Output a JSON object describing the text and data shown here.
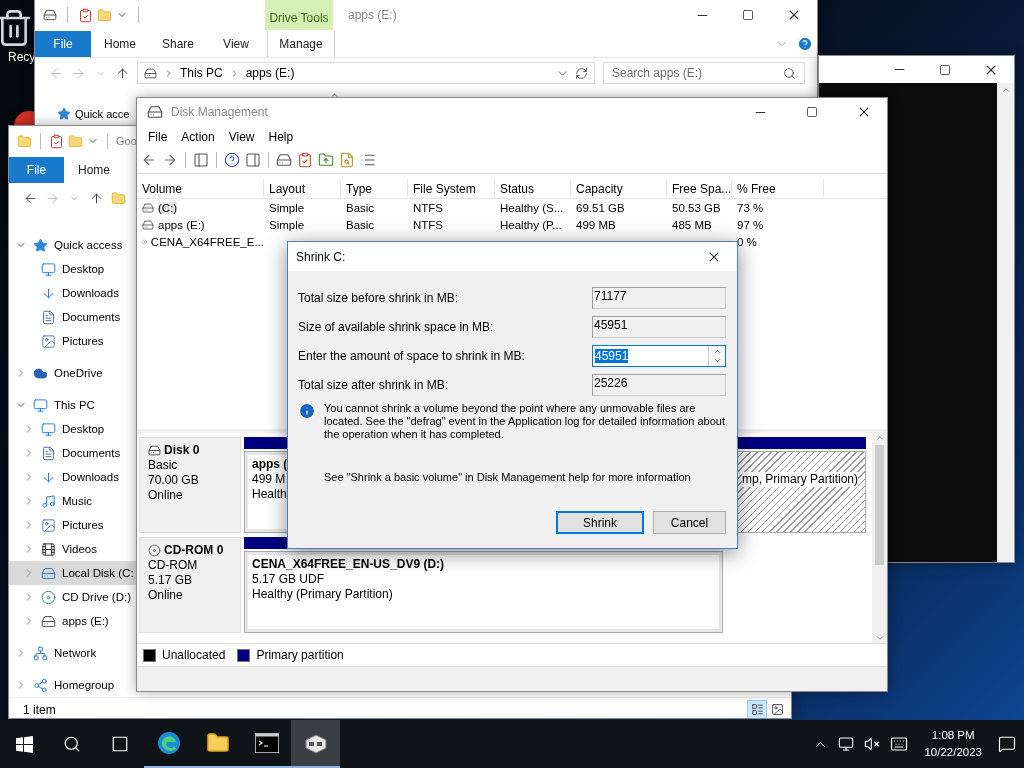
{
  "desktop": {
    "icons": [
      {
        "label": "Recy"
      }
    ]
  },
  "back_explorer": {
    "title": "apps (E:)",
    "context_tab": "Drive Tools",
    "ribbon_tabs": [
      {
        "label": "File",
        "kind": "file"
      },
      {
        "label": "Home",
        "kind": "tab"
      },
      {
        "label": "Share",
        "kind": "tab"
      },
      {
        "label": "View",
        "kind": "tab"
      },
      {
        "label": "Manage",
        "kind": "context"
      }
    ],
    "breadcrumb": [
      "This PC",
      "apps (E:)"
    ],
    "search": {
      "placeholder": "Search apps (E:)"
    },
    "nav_peek": "Quick acce"
  },
  "front_explorer": {
    "title_peek": "Goo",
    "ribbon_tabs": [
      {
        "label": "File",
        "kind": "file"
      },
      {
        "label": "Home",
        "kind": "tab"
      }
    ],
    "nav_tree": [
      {
        "label": "Quick access",
        "kind": "star",
        "expanded": true,
        "selected": false,
        "children": [
          {
            "label": "Desktop",
            "kind": "desktop",
            "selected": false
          },
          {
            "label": "Downloads",
            "kind": "downloads",
            "selected": false
          },
          {
            "label": "Documents",
            "kind": "documents",
            "selected": false
          },
          {
            "label": "Pictures",
            "kind": "pictures",
            "selected": false
          }
        ]
      },
      {
        "label": "OneDrive",
        "kind": "cloud",
        "expanded": false,
        "selected": false
      },
      {
        "label": "This PC",
        "kind": "pc",
        "expanded": true,
        "selected": false,
        "children": [
          {
            "label": "Desktop",
            "kind": "desktop",
            "expanded": false,
            "selected": false
          },
          {
            "label": "Documents",
            "kind": "documents",
            "expanded": false,
            "selected": false
          },
          {
            "label": "Downloads",
            "kind": "downloads",
            "expanded": false,
            "selected": false
          },
          {
            "label": "Music",
            "kind": "music",
            "expanded": false,
            "selected": false
          },
          {
            "label": "Pictures",
            "kind": "pictures",
            "expanded": false,
            "selected": false
          },
          {
            "label": "Videos",
            "kind": "videos",
            "expanded": false,
            "selected": false
          },
          {
            "label": "Local Disk (C:",
            "kind": "localdisk",
            "expanded": false,
            "selected": true
          },
          {
            "label": "CD Drive (D:)",
            "kind": "cd",
            "expanded": false,
            "selected": false
          },
          {
            "label": "apps (E:)",
            "kind": "drive",
            "expanded": false,
            "selected": false
          }
        ]
      },
      {
        "label": "Network",
        "kind": "network",
        "expanded": false,
        "selected": false
      },
      {
        "label": "Homegroup",
        "kind": "homegroup",
        "expanded": false,
        "selected": false
      }
    ],
    "status": "1 item"
  },
  "disk_management": {
    "title": "Disk Management",
    "menu": [
      "File",
      "Action",
      "View",
      "Help"
    ],
    "columns": [
      "Volume",
      "Layout",
      "Type",
      "File System",
      "Status",
      "Capacity",
      "Free Spa...",
      "% Free"
    ],
    "rows": [
      {
        "kind": "disk",
        "cells": [
          "(C:)",
          "Simple",
          "Basic",
          "NTFS",
          "Healthy (S...",
          "69.51 GB",
          "50.53 GB",
          "73 %"
        ],
        "selected": true
      },
      {
        "kind": "disk",
        "cells": [
          "apps (E:)",
          "Simple",
          "Basic",
          "NTFS",
          "Healthy (P...",
          "499 MB",
          "485 MB",
          "97 %"
        ],
        "selected": false
      },
      {
        "kind": "cd",
        "cells": [
          "CENA_X64FREE_E...",
          "",
          "",
          "",
          "",
          "",
          "",
          "0 %"
        ],
        "selected": false
      }
    ],
    "disks": [
      {
        "name": "Disk 0",
        "kind": "disk",
        "lines": [
          "Basic",
          "70.00 GB",
          "Online"
        ],
        "partitions": [
          {
            "title": "apps (",
            "lines": [
              "499 M",
              "Health"
            ],
            "selected": false
          },
          {
            "lines": [
              "mp, Primary Partition)"
            ],
            "selected": true
          }
        ]
      },
      {
        "name": "CD-ROM 0",
        "kind": "cd",
        "lines": [
          "CD-ROM",
          "5.17 GB",
          "Online"
        ],
        "partitions": [
          {
            "title": "CENA_X64FREE_EN-US_DV9  (D:)",
            "lines": [
              "5.17 GB UDF",
              "Healthy (Primary Partition)"
            ],
            "selected": false
          }
        ]
      }
    ],
    "legend": [
      {
        "label": "Unallocated",
        "color": "#000000"
      },
      {
        "label": "Primary partition",
        "color": "#000080"
      }
    ]
  },
  "dialog": {
    "title": "Shrink C:",
    "fields": [
      {
        "label": "Total size before shrink in MB:",
        "value": "71177",
        "kind": "readonly"
      },
      {
        "label": "Size of available shrink space in MB:",
        "value": "45951",
        "kind": "readonly"
      },
      {
        "label": "Enter the amount of space to shrink in MB:",
        "value": "45951",
        "kind": "spinner"
      },
      {
        "label": "Total size after shrink in MB:",
        "value": "25226",
        "kind": "readonly"
      }
    ],
    "info": "You cannot shrink a volume beyond the point where any unmovable files are located. See the \"defrag\" event in the Application log for detailed information about the operation when it has completed.",
    "help": "See \"Shrink a basic volume\" in Disk Management help for more information",
    "buttons": [
      {
        "label": "Shrink",
        "default": true
      },
      {
        "label": "Cancel",
        "default": false
      }
    ]
  },
  "taskbar": {
    "apps": [
      {
        "kind": "edge",
        "selected": false
      },
      {
        "kind": "explorer",
        "selected": false
      },
      {
        "kind": "console",
        "selected": false
      },
      {
        "kind": "diskmgmt",
        "selected": true
      }
    ],
    "clock": {
      "time": "1:08 PM",
      "date": "10/22/2023"
    }
  }
}
